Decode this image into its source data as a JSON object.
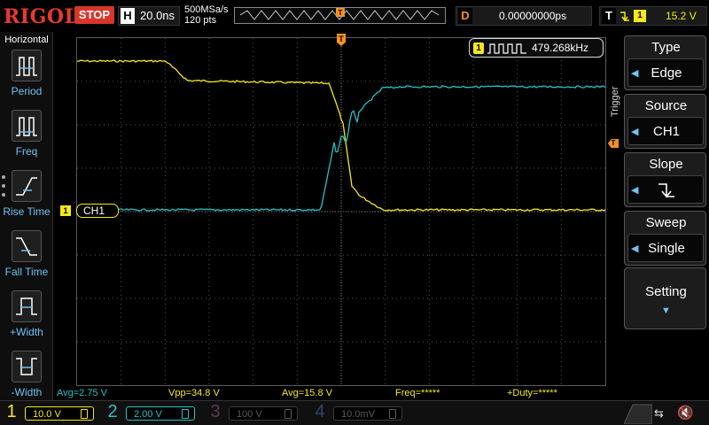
{
  "top": {
    "logo": "RIGOL",
    "run_state": "STOP",
    "horizontal_letter": "H",
    "timebase": "20.0ns",
    "sample_rate": "500MSa/s",
    "points": "120 pts",
    "trigger_marker": "T",
    "delay_letter": "D",
    "delay_value": "0.00000000ps",
    "trigger_letter": "T",
    "trigger_channel": "1",
    "trigger_level": "15.2 V"
  },
  "left_menu": {
    "title": "Horizontal",
    "items": [
      {
        "label": "Period",
        "icon": "period-icon"
      },
      {
        "label": "Freq",
        "icon": "freq-icon"
      },
      {
        "label": "Rise Time",
        "icon": "rise-time-icon"
      },
      {
        "label": "Fall Time",
        "icon": "fall-time-icon"
      },
      {
        "label": "+Width",
        "icon": "positive-width-icon"
      },
      {
        "label": "-Width",
        "icon": "negative-width-icon"
      }
    ]
  },
  "plot": {
    "freq_channel": "1",
    "freq_value": "479.268kHz",
    "ch_marker_num": "1",
    "ch_marker_label": "CH1",
    "trig_top": "T",
    "trig_right": "T",
    "colors": {
      "ch1": "#f6e81a",
      "ch2": "#27c1c7",
      "grid": "#555555",
      "trigger": "#f7921e"
    }
  },
  "measurements": [
    {
      "text": "Avg=2.75 V",
      "color": "#27c1c7"
    },
    {
      "text": "Vpp=34.8 V",
      "color": "#f6e81a"
    },
    {
      "text": "Avg=15.8 V",
      "color": "#f6e81a"
    },
    {
      "text": "Freq=*****",
      "color": "#f6e81a"
    },
    {
      "text": "+Duty=*****",
      "color": "#f6e81a"
    }
  ],
  "channels": [
    {
      "num": "1",
      "scale": "10.0 V",
      "color": "#f6e81a",
      "active": true
    },
    {
      "num": "2",
      "scale": "2.00 V",
      "color": "#27c1c7",
      "active": true
    },
    {
      "num": "3",
      "scale": "100 V",
      "color": "#c43ec0",
      "active": false
    },
    {
      "num": "4",
      "scale": "10.0mV",
      "color": "#3d7fe0",
      "active": false
    }
  ],
  "right_panel": {
    "side_label": "Trigger",
    "type_title": "Type",
    "type_value": "Edge",
    "source_title": "Source",
    "source_value": "CH1",
    "slope_title": "Slope",
    "sweep_title": "Sweep",
    "sweep_value": "Single",
    "setting_label": "Setting"
  },
  "status": {
    "usb": "usb-icon",
    "sound": "speaker-muted-icon"
  }
}
